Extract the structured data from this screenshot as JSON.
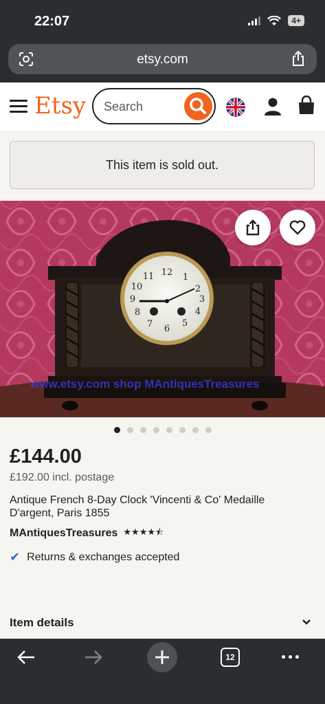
{
  "status_bar": {
    "time": "22:07",
    "battery": "4+"
  },
  "browser": {
    "url": "etsy.com",
    "tab_count": "12"
  },
  "header": {
    "logo": "Etsy",
    "search_placeholder": "Search"
  },
  "notice": {
    "sold_out": "This item is sold out."
  },
  "gallery": {
    "image_count": 8,
    "active_index": 0,
    "watermark": "www.etsy.com  shop  MAntiquesTreasures"
  },
  "listing": {
    "price": "£144.00",
    "old_price": "£192.00 incl. postage",
    "title": "Antique French 8-Day Clock 'Vincenti & Co' Medaille D'argent, Paris 1855",
    "shop_name": "MAntiquesTreasures",
    "rating": 4.5,
    "stars": "★★★★⯪",
    "returns": "Returns & exchanges accepted",
    "section_item_details": "Item details"
  },
  "colors": {
    "accent": "#f1641e",
    "check": "#2e6fd6",
    "chrome": "#2b2e30"
  }
}
